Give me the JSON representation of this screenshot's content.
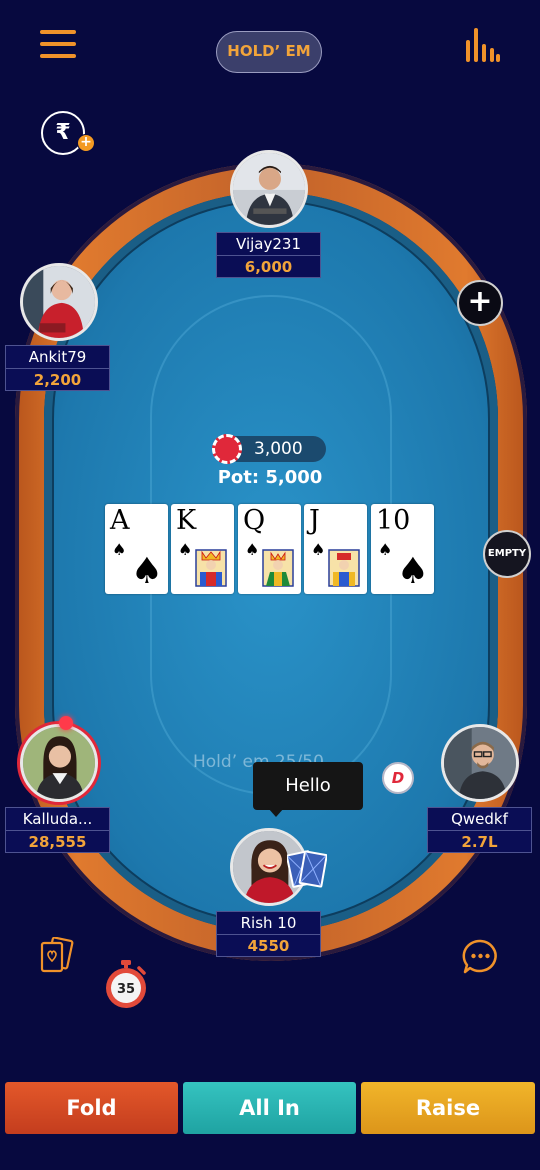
{
  "header": {
    "game_type": "HOLD’ EM",
    "menu_icon": "hamburger-menu-icon",
    "stats_icon": "bar-chart-icon"
  },
  "wallet": {
    "currency_symbol": "₹",
    "plus_symbol": "+"
  },
  "table": {
    "watermark": "Hold’ em 25/50",
    "pot": {
      "chips": "3,000",
      "pot_label": "Pot: 5,000"
    },
    "community_cards": [
      {
        "rank": "A",
        "suit": "♠"
      },
      {
        "rank": "K",
        "suit": "♠"
      },
      {
        "rank": "Q",
        "suit": "♠"
      },
      {
        "rank": "J",
        "suit": "♠"
      },
      {
        "rank": "10",
        "suit": "♠"
      }
    ],
    "add_seat_symbol": "+",
    "empty_seat_label": "EMPTY",
    "dealer_label": "D"
  },
  "players": {
    "top": {
      "name": "Vijay231",
      "chips": "6,000"
    },
    "left_top": {
      "name": "Ankit79",
      "chips": "2,200"
    },
    "left_bottom": {
      "name": "Kalluda...",
      "chips": "28,555"
    },
    "right_bottom": {
      "name": "Qwedkf",
      "chips": "2.7L"
    },
    "self": {
      "name": "Rish 10",
      "chips": "4550"
    }
  },
  "chat_bubble": "Hello",
  "timer": {
    "seconds": "35"
  },
  "actions": {
    "fold": "Fold",
    "all_in": "All In",
    "raise": "Raise"
  },
  "colors": {
    "background": "#07093f",
    "accent_orange": "#f2a43a",
    "fold": "#d84a24",
    "all_in": "#2ab3b1",
    "raise": "#e8a522"
  }
}
